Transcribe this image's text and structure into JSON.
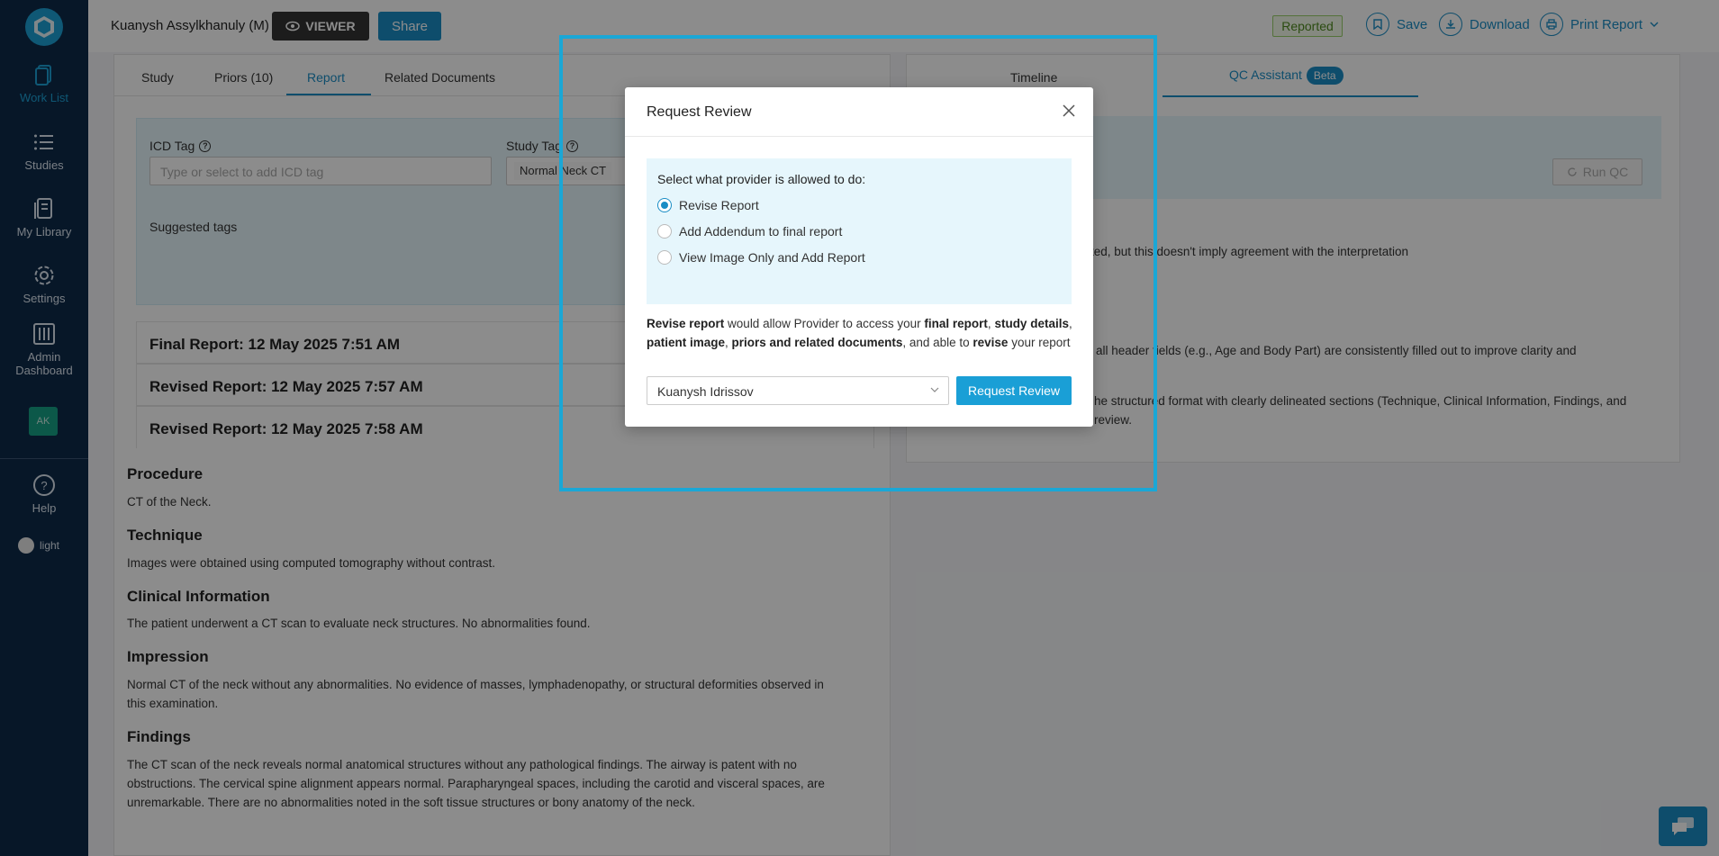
{
  "sidebar": {
    "items": [
      {
        "label": "Work List",
        "icon": "worklist-icon"
      },
      {
        "label": "Studies",
        "icon": "list-icon"
      },
      {
        "label": "My Library",
        "icon": "library-icon"
      },
      {
        "label": "Settings",
        "icon": "gear-icon"
      },
      {
        "label": "Admin Dashboard",
        "icon": "sliders-icon"
      }
    ],
    "avatar": "AK",
    "help": "Help",
    "theme": "light"
  },
  "header": {
    "patient": "Kuanysh Assylkhanuly (M)",
    "viewer": "VIEWER",
    "share": "Share",
    "status": "Reported",
    "save": "Save",
    "download": "Download",
    "print": "Print Report"
  },
  "left": {
    "tabs": [
      "Study",
      "Priors (10)",
      "Report",
      "Related Documents"
    ],
    "icd_label": "ICD Tag",
    "icd_placeholder": "Type or select to add ICD tag",
    "study_tag_label": "Study Tag",
    "study_tag_chip": "Normal Neck CT",
    "suggested": "Suggested tags",
    "reports": [
      "Final Report: 12 May 2025 7:51 AM",
      "Revised Report: 12 May 2025 7:57 AM",
      "Revised Report: 12 May 2025 7:58 AM"
    ],
    "sections": [
      {
        "h": "Procedure",
        "p": "CT of the Neck."
      },
      {
        "h": "Technique",
        "p": "Images were obtained using computed tomography without contrast."
      },
      {
        "h": "Clinical Information",
        "p": "The patient underwent a CT scan to evaluate neck structures. No abnormalities found."
      },
      {
        "h": "Impression",
        "p": "Normal CT of the neck without any abnormalities. No evidence of masses, lymphadenopathy, or structural deformities observed in this examination."
      },
      {
        "h": "Findings",
        "p": "The CT scan of the neck reveals normal anatomical structures without any pathological findings. The airway is patent with no obstructions. The cervical spine alignment appears normal. Parapharyngeal spaces, including the carotid and visceral spaces, are unremarkable. There are no abnormalities noted in the soft tissue structures or bony anatomy of the neck."
      }
    ]
  },
  "right": {
    "tabs": [
      "Timeline",
      "QC Assistant"
    ],
    "beta": "Beta",
    "run_qc": "Run QC",
    "lines": [
      "tected, but this doesn't imply agreement with the interpretation",
      "all header fields (e.g., Age and Body Part) are consistently filled out to improve clarity and",
      "he structured format with clearly delineated sections (Technique, Clinical Information, Findings, and",
      "review."
    ]
  },
  "modal": {
    "title": "Request Review",
    "prompt": "Select what provider is allowed to do:",
    "options": [
      "Revise Report",
      "Add Addendum to final report",
      "View Image Only and Add Report"
    ],
    "selected": 0,
    "desc": {
      "a": "Revise report",
      "b": " would allow Provider to access your ",
      "c": "final report",
      "d": ", ",
      "e": "study details",
      "f": ", ",
      "g": "patient image",
      "h": ", ",
      "i": "priors and related documents",
      "j": ", and able to ",
      "k": "revise",
      "l": " your report"
    },
    "provider": "Kuanysh Idrissov",
    "submit": "Request Review"
  },
  "colors": {
    "accent": "#1a8dc5",
    "sidebar": "#0d2a4a",
    "highlight": "#1aa7d6",
    "status_green": "#4f8a1f"
  }
}
